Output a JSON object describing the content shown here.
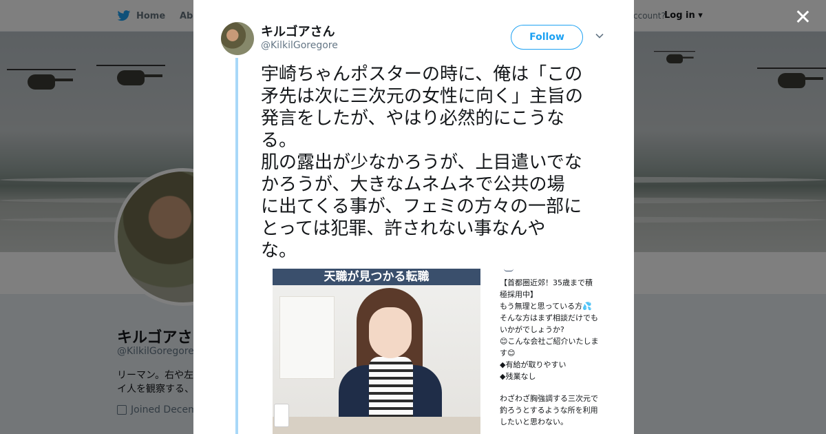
{
  "nav": {
    "home_label": "Home",
    "about_label": "Abo",
    "account_prompt": "ccount?",
    "login_label": "Log in"
  },
  "profile": {
    "name": "キルゴアさ",
    "handle": "@KilkilGoregore",
    "bio_line1": "リーマン。右や左",
    "bio_line2": "イ人を観察する、",
    "joined": "Joined Decem"
  },
  "tweet": {
    "author_name": "キルゴアさん",
    "author_handle": "@KilkilGoregore",
    "follow_label": "Follow",
    "text": "宇崎ちゃんポスターの時に、俺は「この\n矛先は次に三次元の女性に向く」主旨の\n発言をしたが、やはり必然的にこうな\nる。\n肌の露出が少なかろうが、上目遣いでな\nかろうが、大きなムネムネで公共の場\nに出てくる事が、フェミの方々の一部に\nとっては犯罪、許されない事なんや\nな。",
    "media": {
      "ad_header": "天職が見つかる転職",
      "ad_text": "【首都圏近郊！35歳まで積\n極採用中】\nもう無理と思っている方💦\nそんな方はまず相談だけでも\nいかがでしょうか?\n😊こんな会社ご紹介いたしま\nす😊\n◆有給が取りやすい\n◆残業なし",
      "ad_caption": "わざわざ胸強調する三次元で\n釣ろうとするような所を利用\nしたいと思わない。"
    }
  },
  "colors": {
    "accent": "#1da1f2",
    "thread_line": "#a8d8f8",
    "overlay": "rgba(0,0,0,0.5)"
  },
  "icons": {
    "brand": "twitter-bird-icon",
    "close": "close-icon",
    "menu": "chevron-down-icon",
    "calendar": "calendar-icon"
  }
}
